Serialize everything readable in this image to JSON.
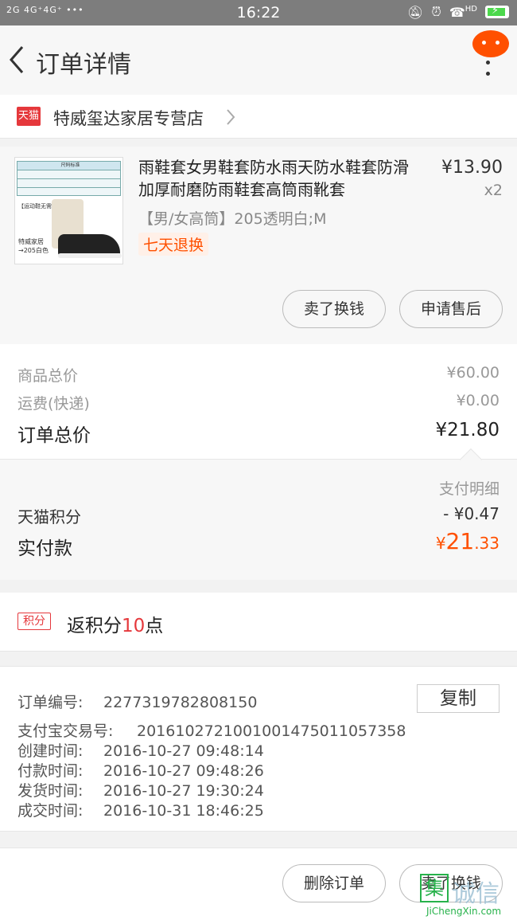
{
  "status_bar": {
    "left": "2G 4G⁺4G⁺ •••",
    "time": "16:22",
    "right_icons": [
      "mute-icon",
      "alarm-icon",
      "hd-call-icon",
      "battery-icon"
    ],
    "hd_label": "HD"
  },
  "header": {
    "title": "订单详情"
  },
  "shop": {
    "logo_text": "天猫",
    "name": "特威玺达家居专营店"
  },
  "item": {
    "title": "雨鞋套女男鞋套防水雨天防水鞋套防滑加厚耐磨防雨鞋套高筒雨靴套",
    "price": "¥13.90",
    "qty": "x2",
    "spec": "【男/女高筒】205透明白;M",
    "tag": "七天退换",
    "thumb_caption": "尺码标准",
    "thumb_tag": "【运动鞋无需加码】",
    "thumb_brand": "特威家居",
    "thumb_code": "→205白色",
    "buttons": {
      "sell": "卖了换钱",
      "after_sale": "申请售后"
    }
  },
  "totals": {
    "goods_label": "商品总价",
    "goods_value": "¥60.00",
    "shipping_label": "运费(快递)",
    "shipping_value": "¥0.00",
    "order_label": "订单总价",
    "order_value": "¥21.80"
  },
  "payment": {
    "detail_label": "支付明细",
    "points_label": "天猫积分",
    "points_value": "- ¥0.47",
    "paid_label": "实付款",
    "paid_currency": "¥",
    "paid_int": "21",
    "paid_dec": ".33"
  },
  "rebate": {
    "icon_text": "积分",
    "prefix": "返积分",
    "points": "10",
    "suffix": "点"
  },
  "order_info": {
    "order_no_label": "订单编号:",
    "order_no": "2277319782808150",
    "copy_label": "复制",
    "alipay_label": "支付宝交易号:",
    "alipay_no": "2016102721001001475011057358",
    "created_label": "创建时间:",
    "created": "2016-10-27  09:48:14",
    "paid_label": "付款时间:",
    "paid": "2016-10-27  09:48:26",
    "shipped_label": "发货时间:",
    "shipped": "2016-10-27  19:30:24",
    "done_label": "成交时间:",
    "done": "2016-10-31  18:46:25"
  },
  "footer": {
    "delete_label": "删除订单",
    "sell_label": "卖了换钱"
  },
  "watermark": {
    "mark": "集",
    "text": "诚信",
    "url": "JiChengXin.com"
  },
  "colors": {
    "accent": "#ff5000",
    "tmall_red": "#e5383c",
    "statusbar": "#7d7d7d"
  }
}
